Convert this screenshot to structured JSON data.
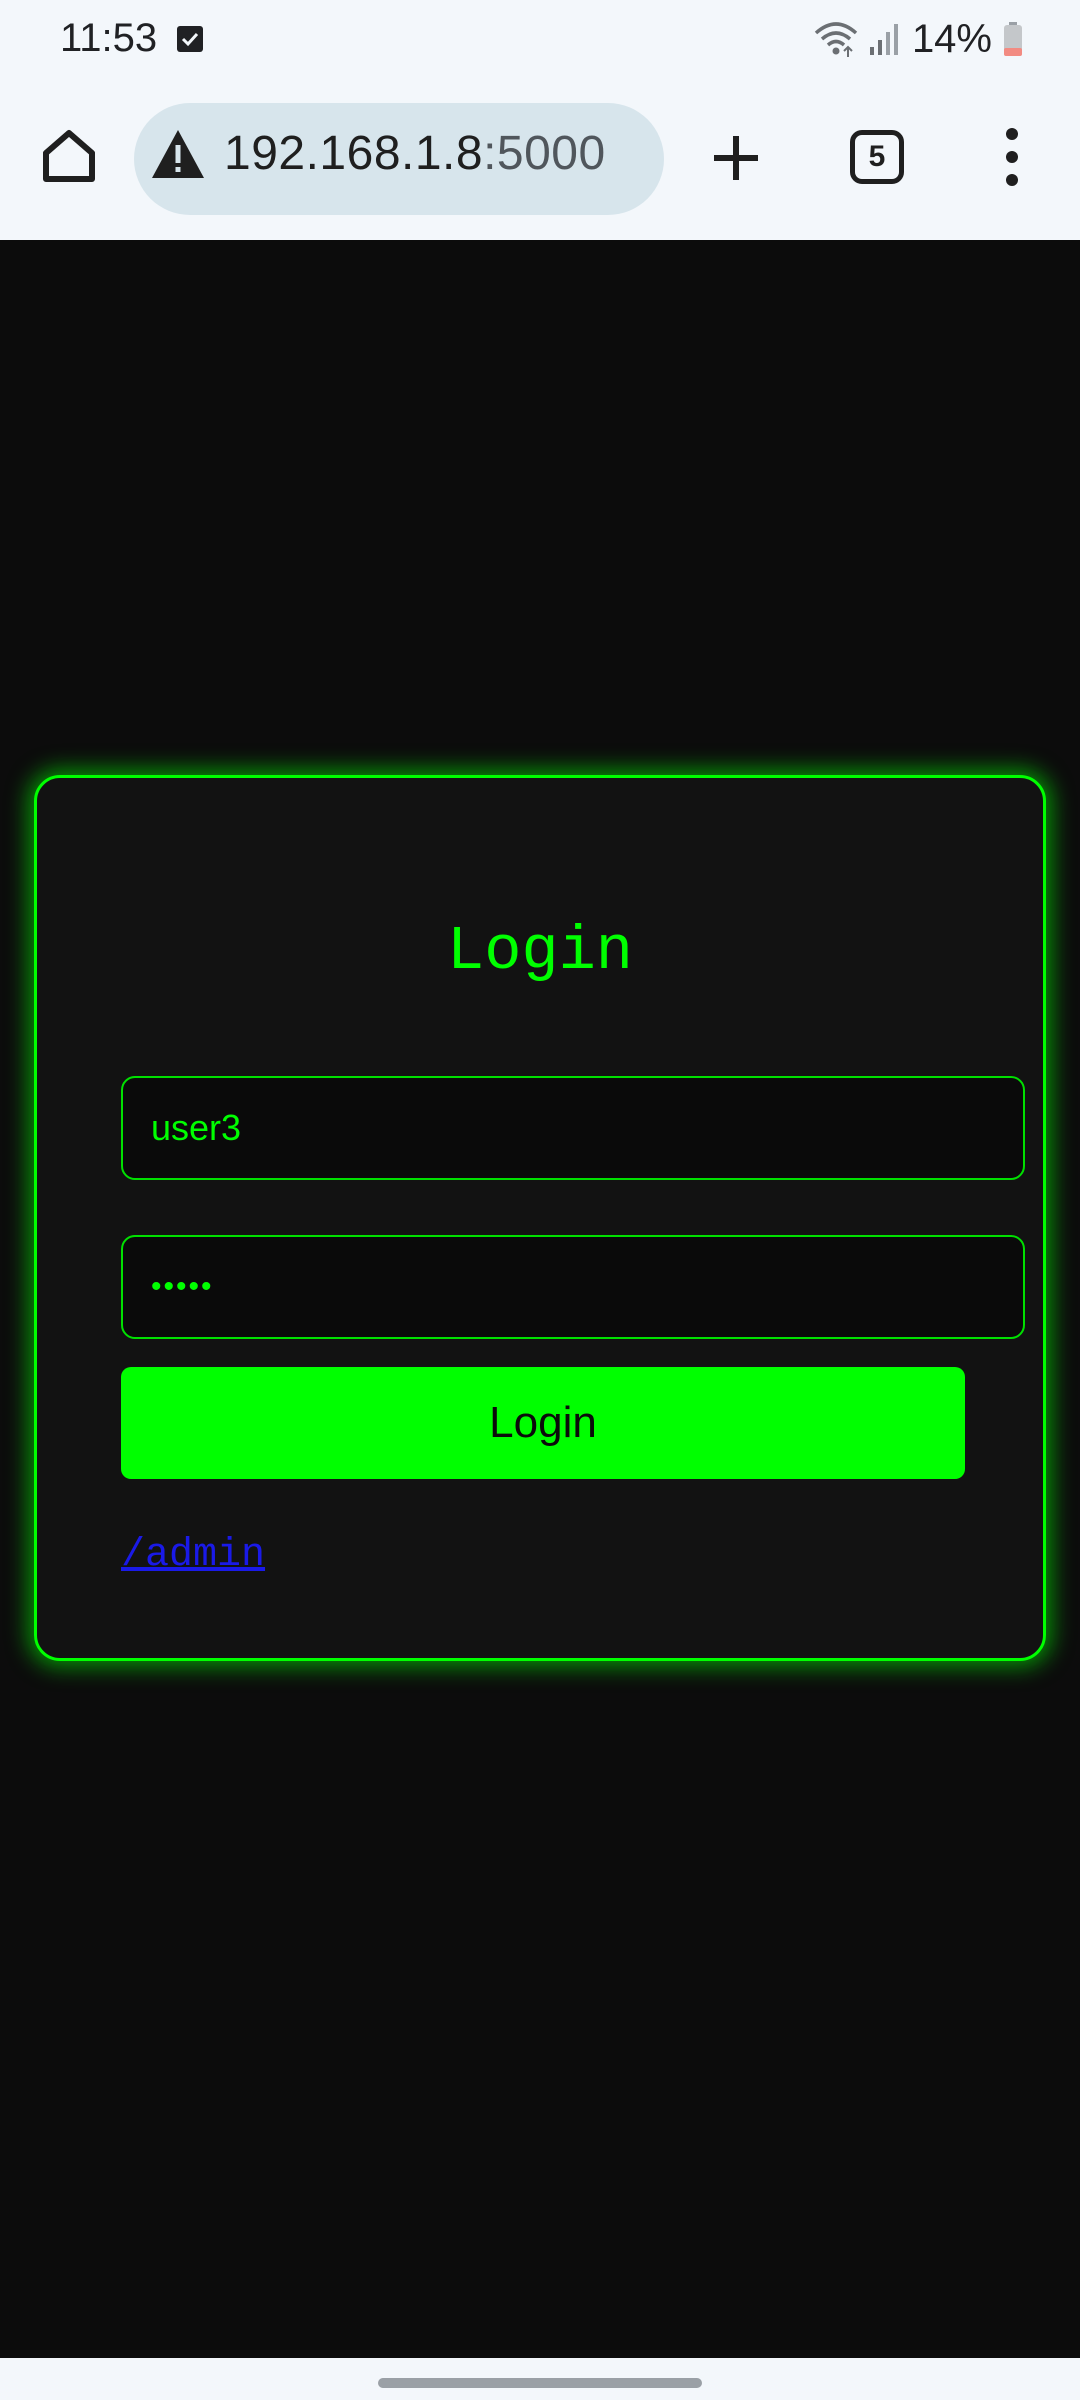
{
  "status_bar": {
    "time": "11:53",
    "battery_percent": "14%",
    "icons": [
      "notification-check-icon",
      "wifi-icon",
      "signal-icon",
      "battery-icon"
    ]
  },
  "browser": {
    "url_host": "192.168.1.8",
    "url_port": ":5000",
    "tab_count": "5",
    "icons": [
      "home-icon",
      "warning-icon",
      "plus-icon",
      "more-vert-icon"
    ]
  },
  "login": {
    "title": "Login",
    "username_value": "user3",
    "password_value": "•••••",
    "button_label": "Login",
    "admin_link": "/admin"
  },
  "colors": {
    "accent": "#00ff00",
    "background": "#0c0c0c",
    "card": "#121212",
    "link": "#1a1ae8"
  }
}
